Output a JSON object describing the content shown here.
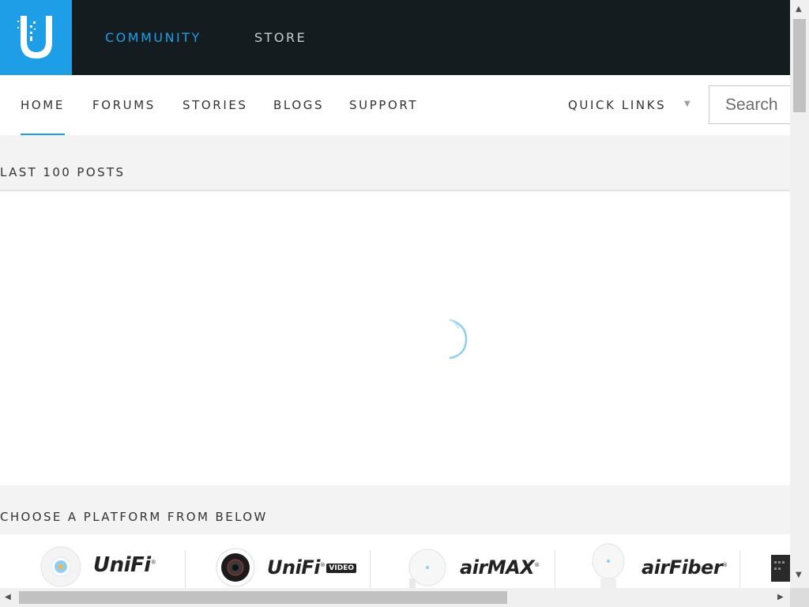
{
  "header": {
    "logo_icon": "ubiquiti-u-logo",
    "brand_color": "#1e9ee6",
    "nav": [
      {
        "label": "COMMUNITY",
        "active": true
      },
      {
        "label": "STORE",
        "active": false
      }
    ]
  },
  "subnav": {
    "items": [
      "HOME",
      "FORUMS",
      "STORIES",
      "BLOGS",
      "SUPPORT"
    ],
    "active": "HOME",
    "quick_links": "QUICK LINKS",
    "quick_links_icon": "caret-down-icon",
    "search_placeholder": "Search"
  },
  "posts": {
    "title": "LAST 100 POSTS",
    "loading_icon": "spinner-icon"
  },
  "platforms": {
    "title": "CHOOSE A PLATFORM FROM BELOW",
    "items": [
      {
        "brand": "UniFi",
        "mark": "®"
      },
      {
        "brand": "UniFi",
        "mark": "®",
        "badge": "VIDEO"
      },
      {
        "brand": "airMAX",
        "mark": "®"
      },
      {
        "brand": "airFiber",
        "mark": "®"
      }
    ]
  }
}
